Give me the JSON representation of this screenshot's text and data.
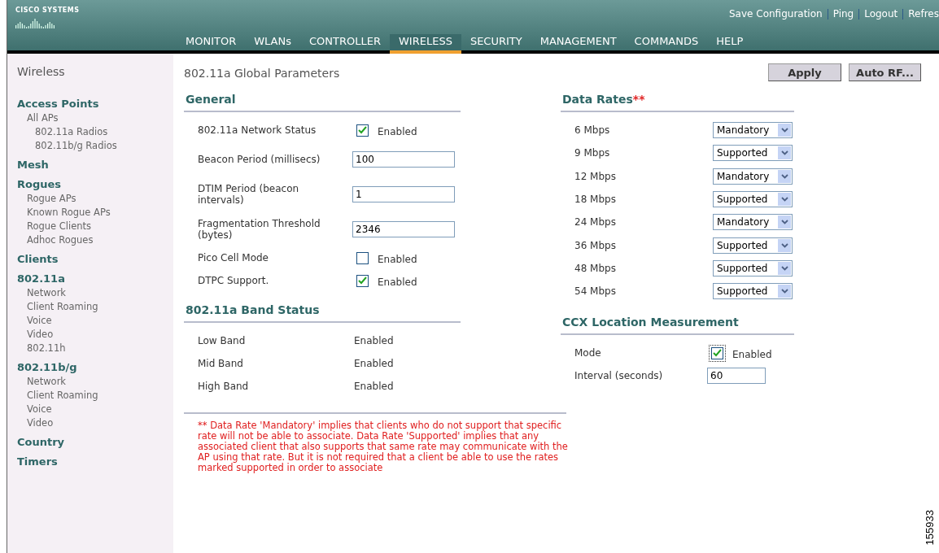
{
  "header": {
    "brand": "CISCO SYSTEMS",
    "links": [
      "Save Configuration",
      "Ping",
      "Logout",
      "Refres"
    ],
    "menu": [
      {
        "label": "MONITOR",
        "selected": false
      },
      {
        "label": "WLANs",
        "selected": false
      },
      {
        "label": "CONTROLLER",
        "selected": false
      },
      {
        "label": "WIRELESS",
        "selected": true
      },
      {
        "label": "SECURITY",
        "selected": false
      },
      {
        "label": "MANAGEMENT",
        "selected": false
      },
      {
        "label": "COMMANDS",
        "selected": false
      },
      {
        "label": "HELP",
        "selected": false
      }
    ]
  },
  "sidebar": {
    "title": "Wireless",
    "sections": [
      {
        "label": "Access Points",
        "children": [
          {
            "label": "All APs",
            "children": [
              {
                "label": "802.11a Radios"
              },
              {
                "label": "802.11b/g Radios"
              }
            ]
          }
        ]
      },
      {
        "label": "Mesh"
      },
      {
        "label": "Rogues",
        "children": [
          {
            "label": "Rogue APs"
          },
          {
            "label": "Known Rogue APs"
          },
          {
            "label": "Rogue Clients"
          },
          {
            "label": "Adhoc Rogues"
          }
        ]
      },
      {
        "label": "Clients"
      },
      {
        "label": "802.11a",
        "children": [
          {
            "label": "Network"
          },
          {
            "label": "Client Roaming"
          },
          {
            "label": "Voice"
          },
          {
            "label": "Video"
          },
          {
            "label": "802.11h"
          }
        ]
      },
      {
        "label": "802.11b/g",
        "children": [
          {
            "label": "Network"
          },
          {
            "label": "Client Roaming"
          },
          {
            "label": "Voice"
          },
          {
            "label": "Video"
          }
        ]
      },
      {
        "label": "Country"
      },
      {
        "label": "Timers"
      }
    ]
  },
  "page": {
    "title": "802.11a Global Parameters",
    "buttons": [
      "Apply",
      "Auto RF..."
    ]
  },
  "general": {
    "title": "General",
    "rows": [
      {
        "kind": "checkbox",
        "label": "802.11a Network Status",
        "checked": true,
        "option": "Enabled"
      },
      {
        "kind": "text",
        "label": "Beacon Period (millisecs)",
        "value": "100"
      },
      {
        "kind": "text",
        "label": "DTIM Period (beacon intervals)",
        "value": "1"
      },
      {
        "kind": "text",
        "label": "Fragmentation Threshold (bytes)",
        "value": "2346"
      },
      {
        "kind": "checkbox",
        "label": "Pico Cell Mode",
        "checked": false,
        "option": "Enabled"
      },
      {
        "kind": "checkbox",
        "label": "DTPC Support.",
        "checked": true,
        "option": "Enabled"
      }
    ]
  },
  "band_status": {
    "title": "802.11a Band Status",
    "rows": [
      {
        "label": "Low Band",
        "value": "Enabled"
      },
      {
        "label": "Mid Band",
        "value": "Enabled"
      },
      {
        "label": "High Band",
        "value": "Enabled"
      }
    ]
  },
  "data_rates": {
    "title": "Data Rates",
    "marker": "**",
    "rows": [
      {
        "label": "6 Mbps",
        "value": "Mandatory"
      },
      {
        "label": "9 Mbps",
        "value": "Supported"
      },
      {
        "label": "12 Mbps",
        "value": "Mandatory"
      },
      {
        "label": "18 Mbps",
        "value": "Supported"
      },
      {
        "label": "24 Mbps",
        "value": "Mandatory"
      },
      {
        "label": "36 Mbps",
        "value": "Supported"
      },
      {
        "label": "48 Mbps",
        "value": "Supported"
      },
      {
        "label": "54 Mbps",
        "value": "Supported"
      }
    ]
  },
  "ccx": {
    "title": "CCX Location Measurement",
    "rows": [
      {
        "kind": "checkbox",
        "label": "Mode",
        "checked": true,
        "focused": true,
        "option": "Enabled"
      },
      {
        "kind": "text",
        "label": "Interval (seconds)",
        "value": "60"
      }
    ]
  },
  "footnote": "** Data Rate 'Mandatory' implies that clients who do not support that specific rate will not be able to associate. Data Rate 'Supported' implies that any associated client that also supports that same rate may communicate with the AP using that rate. But it is not required that a client be able to use the rates marked supported in order to associate",
  "figure_id": "155933"
}
